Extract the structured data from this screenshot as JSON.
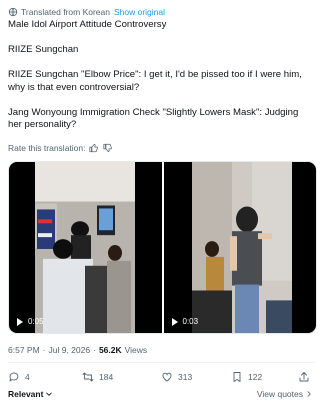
{
  "translation": {
    "notice": "Translated from Korean",
    "show_original": "Show original",
    "rate_label": "Rate this translation:"
  },
  "tweet": {
    "lines": [
      "Male Idol Airport Attitude Controversy",
      "RIIZE Sungchan",
      "RIIZE Sungchan \"Elbow Price\": I get it, I'd be pissed too if I were him, why is that even controversial?",
      "Jang Wonyoung Immigration Check \"Slightly Lowers Mask\": Judging her personality?"
    ]
  },
  "media": {
    "videos": [
      {
        "duration": "0:05"
      },
      {
        "duration": "0:03"
      }
    ]
  },
  "meta": {
    "time": "6:57 PM",
    "date": "Jul 9, 2026",
    "views_count": "56.2K",
    "views_label": "Views",
    "separator": "·"
  },
  "actions": {
    "reply_count": "4",
    "retweet_count": "184",
    "like_count": "313",
    "bookmark_count": "122"
  },
  "footer": {
    "sort_label": "Relevant",
    "quotes_label": "View quotes"
  }
}
